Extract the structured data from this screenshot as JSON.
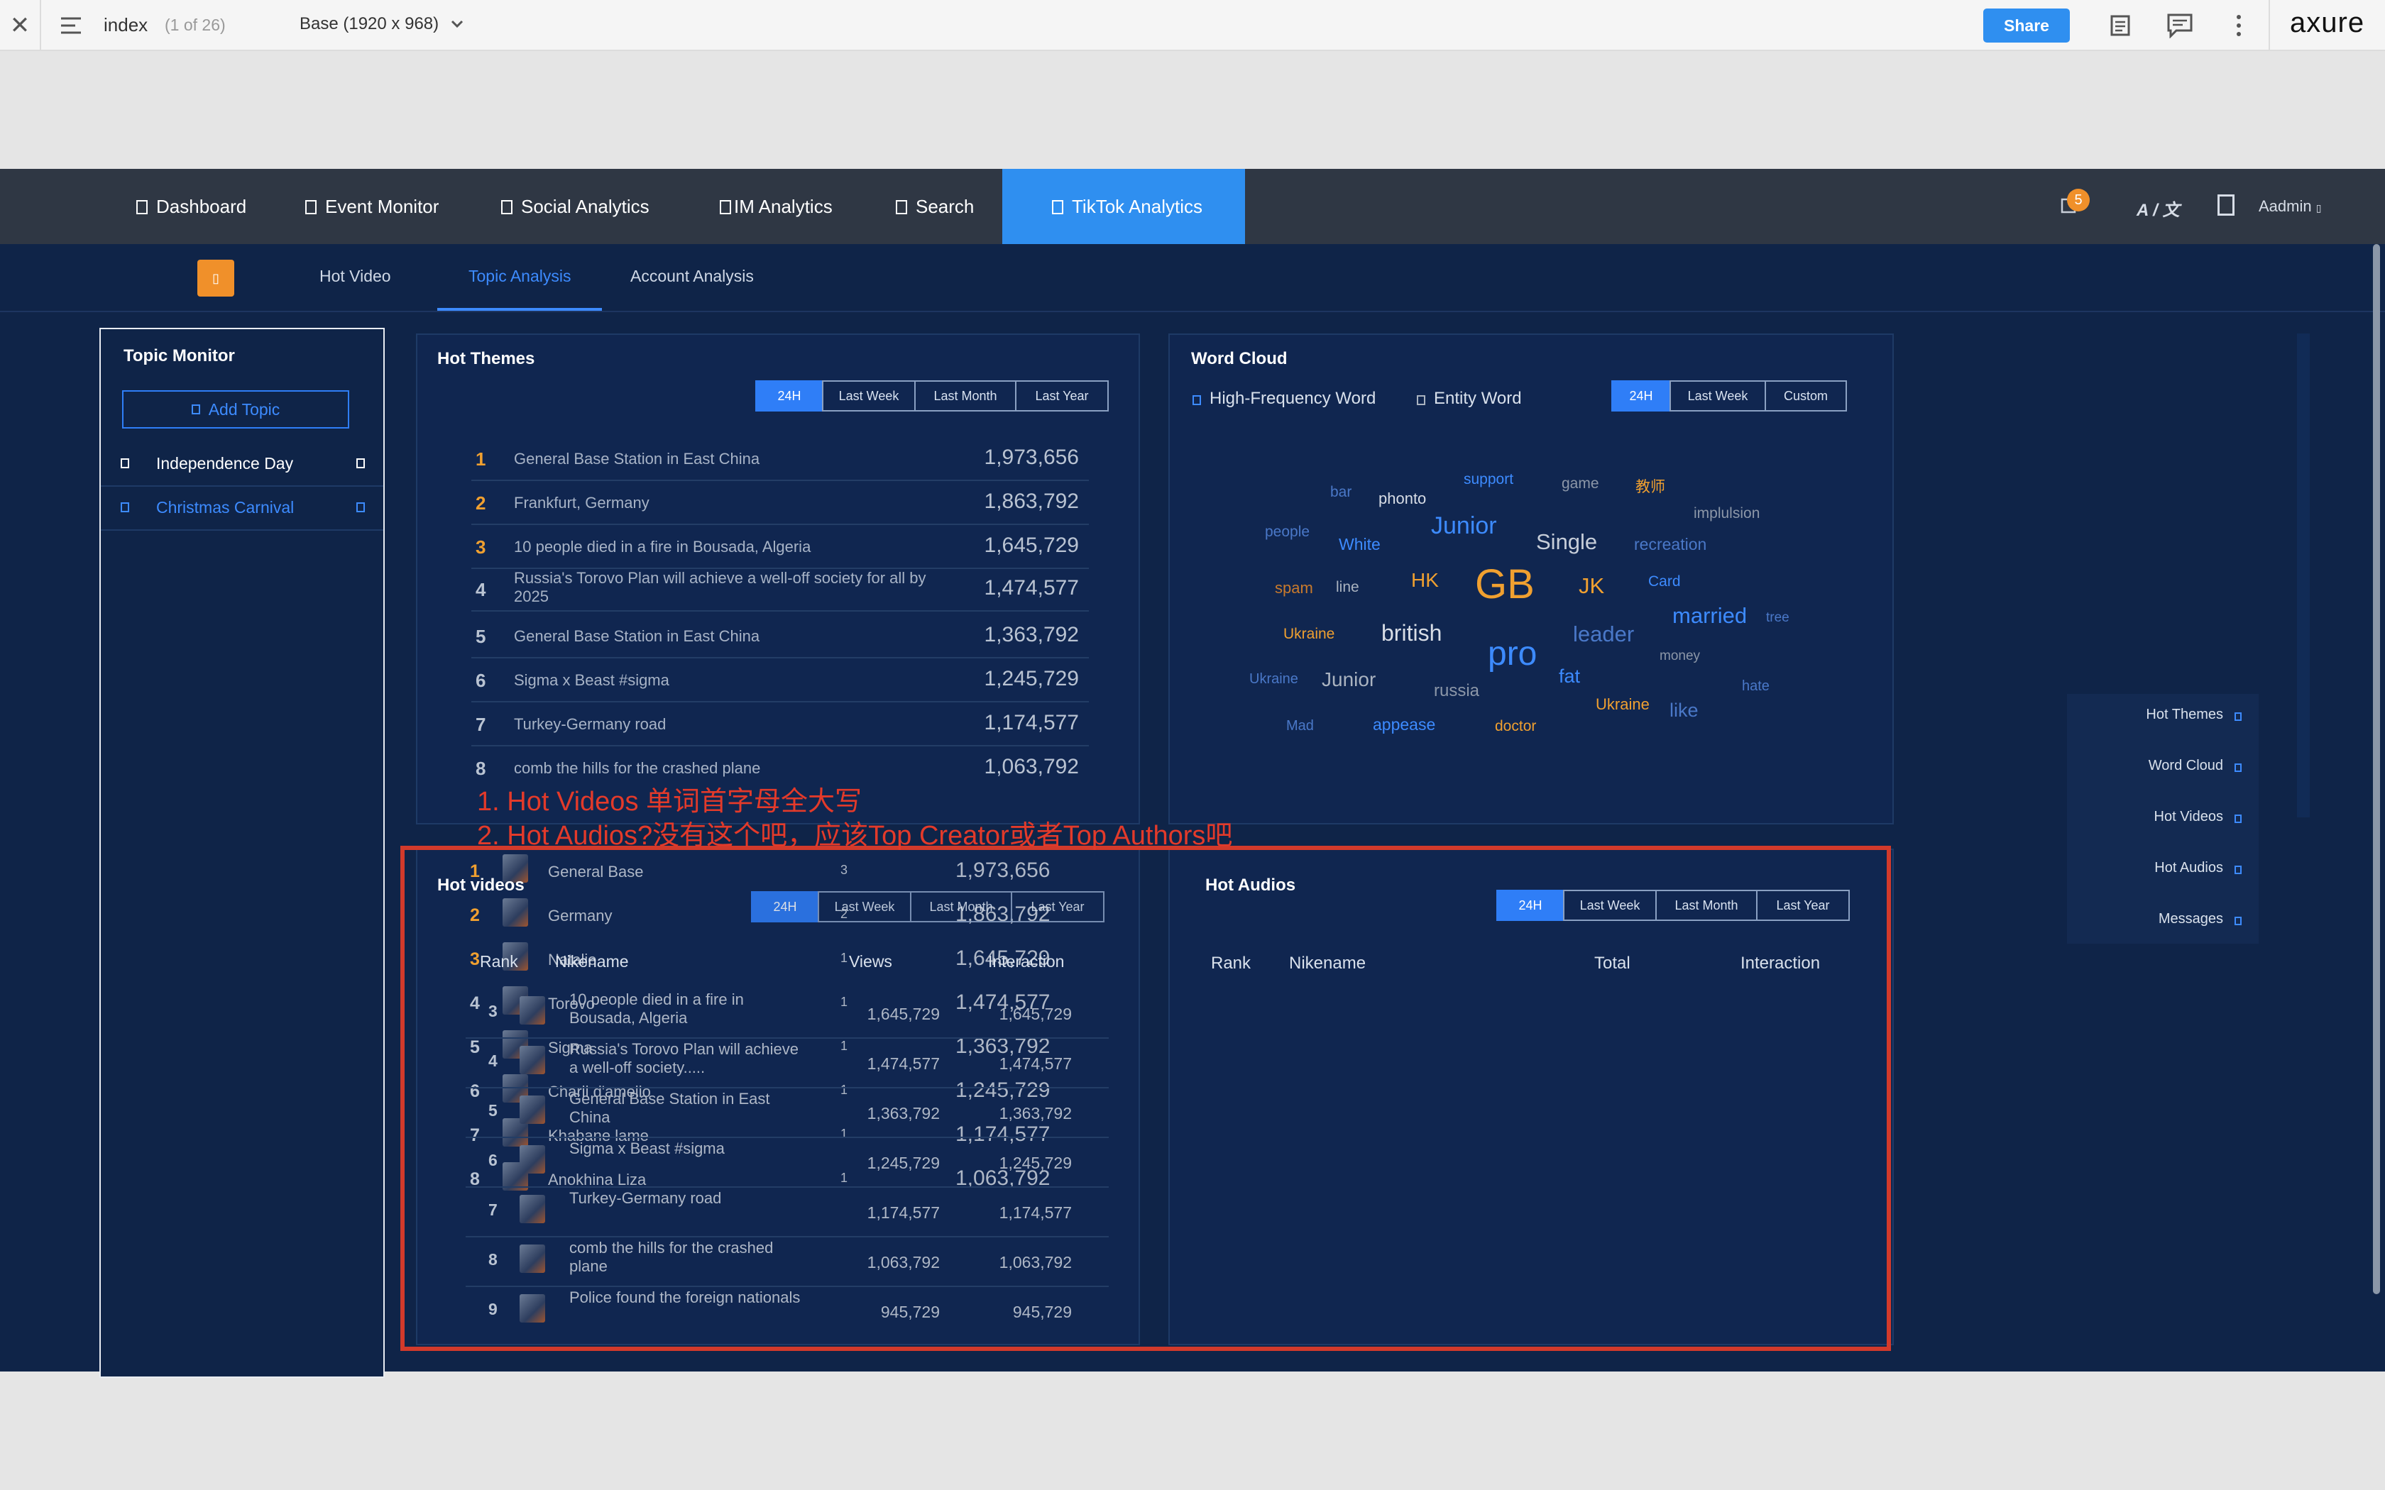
{
  "axure": {
    "page_name": "index",
    "page_count": "(1 of 26)",
    "view": "Base (1920 x 968)",
    "share_label": "Share",
    "logo": "axure",
    "icons": [
      "close-icon",
      "menu-icon",
      "chevron-down-icon",
      "notes-icon",
      "comments-icon",
      "more-icon"
    ]
  },
  "nav": {
    "items": [
      {
        "label": "Dashboard"
      },
      {
        "label": "Event Monitor"
      },
      {
        "label": "Social Analytics"
      },
      {
        "label": "IM Analytics"
      },
      {
        "label": "Search"
      },
      {
        "label": "TikTok Analytics"
      }
    ],
    "badge": "5",
    "lang": "A / 文",
    "user": "Aadmin"
  },
  "subnav": {
    "logo_glyph": "▯",
    "tabs": [
      {
        "label": "Hot Video"
      },
      {
        "label": "Topic Analysis"
      },
      {
        "label": "Account Analysis"
      }
    ],
    "active": "Topic Analysis"
  },
  "topic_monitor": {
    "title": "Topic Monitor",
    "add_label": "Add Topic",
    "items": [
      {
        "label": "Independence Day"
      },
      {
        "label": "Christmas Carnival"
      }
    ]
  },
  "hot_themes": {
    "title": "Hot Themes",
    "filters": [
      "24H",
      "Last Week",
      "Last Month",
      "Last Year"
    ],
    "rows": [
      {
        "rank": "1",
        "text": "General Base Station in East China",
        "value": "1,973,656"
      },
      {
        "rank": "2",
        "text": "Frankfurt, Germany",
        "value": "1,863,792"
      },
      {
        "rank": "3",
        "text": "10 people died in a fire in Bousada, Algeria",
        "value": "1,645,729"
      },
      {
        "rank": "4",
        "text": "Russia's Torovo Plan will achieve a well-off society for all by 2025",
        "value": "1,474,577"
      },
      {
        "rank": "5",
        "text": "General Base Station in East China",
        "value": "1,363,792"
      },
      {
        "rank": "6",
        "text": "Sigma x Beast #sigma",
        "value": "1,245,729"
      },
      {
        "rank": "7",
        "text": " Turkey-Germany road",
        "value": "1,174,577"
      },
      {
        "rank": "8",
        "text": "comb the hills for the crashed plane",
        "value": "1,063,792"
      }
    ]
  },
  "word_cloud": {
    "title": "Word Cloud",
    "options": [
      "High-Frequency Word",
      "Entity Word"
    ],
    "filters": [
      "24H",
      "Last Week",
      "Custom"
    ],
    "words": [
      {
        "text": "bar",
        "color": "#4a78c8"
      },
      {
        "text": "phonto",
        "color": "#d8dde6"
      },
      {
        "text": "support",
        "color": "#3d8bff"
      },
      {
        "text": "game",
        "color": "#8c97a8"
      },
      {
        "text": "教师",
        "color": "#f0a030"
      },
      {
        "text": "people",
        "color": "#4a78c8"
      },
      {
        "text": "White",
        "color": "#3d8bff"
      },
      {
        "text": "Junior",
        "color": "#3d8bff"
      },
      {
        "text": "Single",
        "color": "#c7ced9"
      },
      {
        "text": "recreation",
        "color": "#4a78c8"
      },
      {
        "text": "implulsion",
        "color": "#8c97a8"
      },
      {
        "text": "spam",
        "color": "#c97a2c"
      },
      {
        "text": "line",
        "color": "#aab3c0"
      },
      {
        "text": "HK",
        "color": "#f0a030"
      },
      {
        "text": "GB",
        "color": "#f0a030"
      },
      {
        "text": "JK",
        "color": "#f0a030"
      },
      {
        "text": "Card",
        "color": "#3d8bff"
      },
      {
        "text": "Ukraine",
        "color": "#f0a030"
      },
      {
        "text": "british",
        "color": "#d8dde6"
      },
      {
        "text": "leader",
        "color": "#4a78c8"
      },
      {
        "text": "married",
        "color": "#3d8bff"
      },
      {
        "text": "tree",
        "color": "#4a78c8"
      },
      {
        "text": "pro",
        "color": "#3d8bff"
      },
      {
        "text": "money",
        "color": "#8c97a8"
      },
      {
        "text": "Ukraine",
        "color": "#4a78c8"
      },
      {
        "text": "Junior",
        "color": "#aab3c0"
      },
      {
        "text": "russia",
        "color": "#8c97a8"
      },
      {
        "text": "fat",
        "color": "#3d8bff"
      },
      {
        "text": "hate",
        "color": "#4a78c8"
      },
      {
        "text": "Ukraine",
        "color": "#f0a030"
      },
      {
        "text": "like",
        "color": "#4a78c8"
      },
      {
        "text": "Mad",
        "color": "#4a78c8"
      },
      {
        "text": "appease",
        "color": "#3d8bff"
      },
      {
        "text": "doctor",
        "color": "#f0a030"
      }
    ]
  },
  "right_menu": {
    "items": [
      {
        "label": "Hot Themes"
      },
      {
        "label": "Word Cloud"
      },
      {
        "label": "Hot Videos"
      },
      {
        "label": "Hot Audios"
      },
      {
        "label": "Messages"
      }
    ]
  },
  "annotation": {
    "line1": "1. Hot Videos 单词首字母全大写",
    "line2": "2. Hot Audios?没有这个吧，应该Top Creator或者Top Authors吧"
  },
  "hot_videos": {
    "title": "Hot videos",
    "filters": [
      "24H",
      "Last Week",
      "Last Month",
      "Last Year"
    ],
    "headers": {
      "rank": "Rank",
      "name": "Nikename",
      "views": "Views",
      "interaction": "Interaction"
    },
    "ghost_rows": [
      {
        "rank": "1",
        "name": "General Base",
        "count": "3",
        "value": "1,973,656"
      },
      {
        "rank": "2",
        "name": "Germany",
        "count": "2",
        "value": "1,863,792"
      },
      {
        "rank": "3",
        "name": "Natalie",
        "count": "1",
        "value": "1,645,729"
      },
      {
        "rank": "4",
        "name": "Torovo",
        "count": "1",
        "value": "1,474,577"
      },
      {
        "rank": "5",
        "name": "Sigma",
        "count": "1",
        "value": "1,363,792"
      },
      {
        "rank": "6",
        "name": "Charli d'amelio",
        "count": "1",
        "value": "1,245,729"
      },
      {
        "rank": "7",
        "name": "Khabane lame",
        "count": "1",
        "value": "1,174,577"
      },
      {
        "rank": "8",
        "name": "Anokhina Liza",
        "count": "1",
        "value": "1,063,792"
      }
    ],
    "rows": [
      {
        "rank": "3",
        "name": "10 people died in a fire in Bousada, Algeria",
        "views": "1,645,729",
        "interaction": "1,645,729"
      },
      {
        "rank": "4",
        "name": "Russia's Torovo Plan will achieve a well-off society.....",
        "views": "1,474,577",
        "interaction": "1,474,577"
      },
      {
        "rank": "5",
        "name": "General Base Station in East China",
        "views": "1,363,792",
        "interaction": "1,363,792"
      },
      {
        "rank": "6",
        "name": "Sigma x Beast #sigma",
        "views": "1,245,729",
        "interaction": "1,245,729"
      },
      {
        "rank": "7",
        "name": "Turkey-Germany road",
        "views": "1,174,577",
        "interaction": "1,174,577"
      },
      {
        "rank": "8",
        "name": "comb the hills for the crashed plane",
        "views": "1,063,792",
        "interaction": "1,063,792"
      },
      {
        "rank": "9",
        "name": "Police found the foreign nationals",
        "views": "945,729",
        "interaction": "945,729"
      }
    ]
  },
  "hot_audios": {
    "title": "Hot  Audios",
    "filters": [
      "24H",
      "Last Week",
      "Last Month",
      "Last Year"
    ],
    "headers": {
      "rank": "Rank",
      "name": "Nikename",
      "total": "Total",
      "interaction": "Interaction"
    }
  },
  "colors": {
    "accent": "#2f7ef7",
    "nav_bg": "#2f3744",
    "app_bg": "#0f2448",
    "rank_orange": "#f0a030",
    "annotation_red": "#e33a2a"
  }
}
